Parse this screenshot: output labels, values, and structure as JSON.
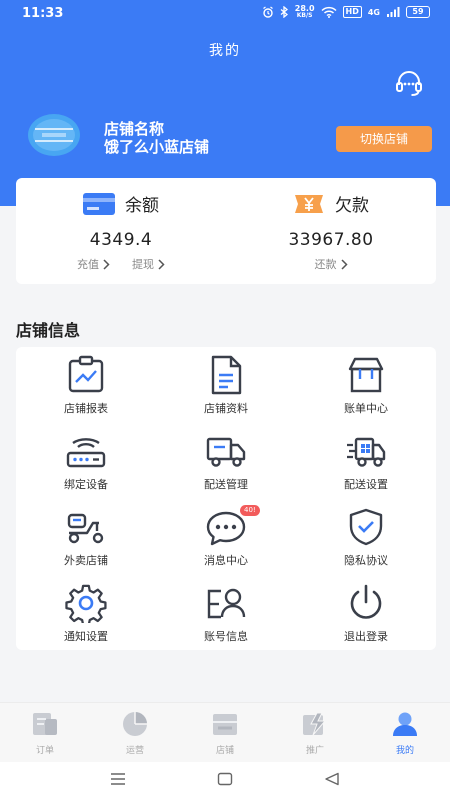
{
  "status_bar": {
    "time": "11:33",
    "net_speed_value": "28.0",
    "net_speed_unit": "KB/S",
    "hd": "HD",
    "signal": "4G",
    "battery": "59"
  },
  "header": {
    "title": "我的"
  },
  "store": {
    "name_label": "店铺名称",
    "name": "饿了么小蓝店铺",
    "switch_label": "切换店铺"
  },
  "balance": {
    "left": {
      "title": "余额",
      "value": "4349.4",
      "links": [
        "充值",
        "提现"
      ]
    },
    "right": {
      "title": "欠款",
      "value": "33967.80",
      "links": [
        "还款"
      ]
    }
  },
  "section": {
    "title": "店铺信息"
  },
  "grid": [
    {
      "label": "店铺报表",
      "icon": "report-icon"
    },
    {
      "label": "店铺资料",
      "icon": "document-icon"
    },
    {
      "label": "账单中心",
      "icon": "box-icon"
    },
    {
      "label": "绑定设备",
      "icon": "router-icon"
    },
    {
      "label": "配送管理",
      "icon": "truck-icon"
    },
    {
      "label": "配送设置",
      "icon": "fast-truck-icon"
    },
    {
      "label": "外卖店铺",
      "icon": "scooter-icon"
    },
    {
      "label": "消息中心",
      "icon": "chat-icon"
    },
    {
      "label": "隐私协议",
      "icon": "shield-icon"
    },
    {
      "label": "通知设置",
      "icon": "gear-icon"
    },
    {
      "label": "账号信息",
      "icon": "account-icon"
    },
    {
      "label": "退出登录",
      "icon": "power-icon"
    }
  ],
  "message_badge": "40!",
  "tabs": [
    {
      "label": "订单",
      "icon": "order-tab-icon",
      "active": false
    },
    {
      "label": "运营",
      "icon": "pie-tab-icon",
      "active": false
    },
    {
      "label": "店铺",
      "icon": "store-tab-icon",
      "active": false
    },
    {
      "label": "推广",
      "icon": "promo-tab-icon",
      "active": false
    },
    {
      "label": "我的",
      "icon": "profile-tab-icon",
      "active": true
    }
  ],
  "colors": {
    "primary": "#3b7bf5",
    "accent_orange": "#f59a4a",
    "badge_red": "#f25b5b",
    "icon_dark": "#3a3f4a"
  }
}
